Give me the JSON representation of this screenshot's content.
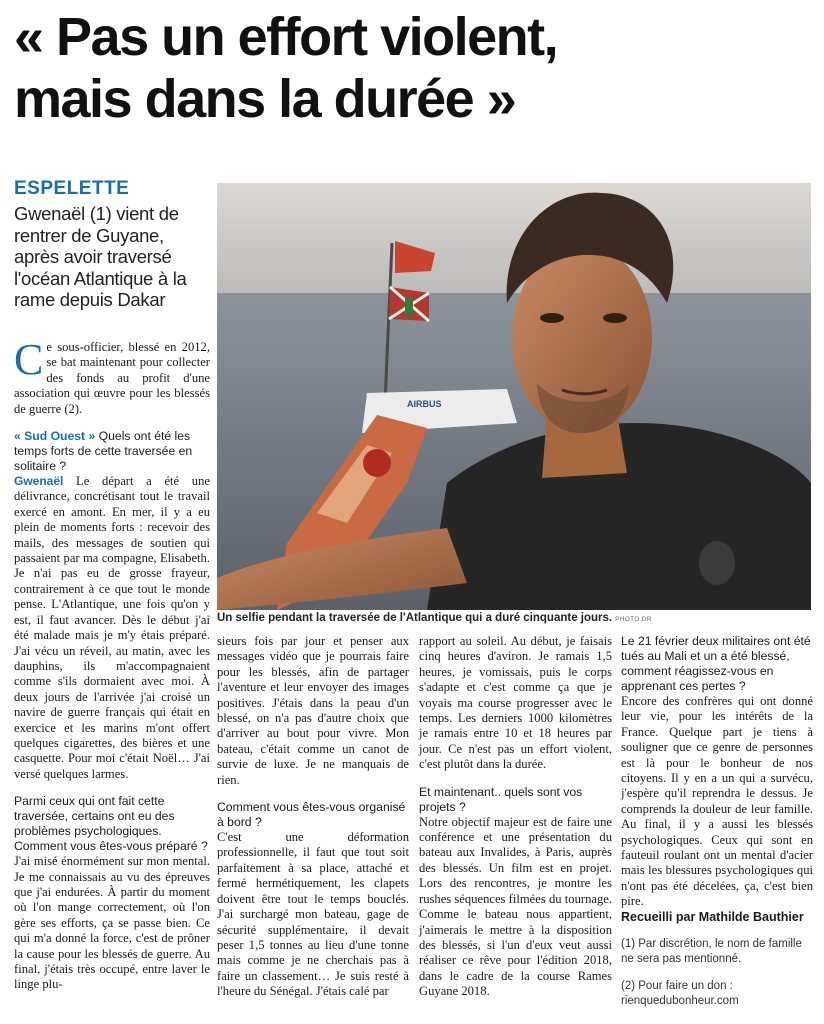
{
  "headline": {
    "line1": "« Pas un effort violent,",
    "line2": "mais dans la durée »"
  },
  "kicker": "ESPELETTE",
  "standfirst": "Gwenaël (1) vient de rentrer de Guyane, après avoir traversé l'océan Atlantique à la rame depuis Dakar",
  "photo": {
    "boat_label": "AIRBUS",
    "caption": "Un selfie pendant la traversée de l'Atlantique qui a duré cinquante jours.",
    "credit": "PHOTO DR"
  },
  "column1": {
    "intro_dropcap": "C",
    "intro": "e sous-officier, blessé en 2012, se bat maintenant pour collecter des fonds au profit d'une association qui œuvre pour les blessés de guerre (2).",
    "q1_lead": "« Sud Ouest »",
    "q1_rest": "Quels ont été les temps forts de cette traversée en solitaire ?",
    "a1_lead": "Gwenaël",
    "a1": "Le départ a été une délivrance, concrétisant tout le travail exercé en amont. En mer, il y a eu plein de moments forts : recevoir des mails, des messages de soutien qui passaient par ma compagne, Elisabeth. Je n'ai pas eu de grosse frayeur, contrairement à ce que tout le monde pense. L'Atlantique, une fois qu'on y est, il faut avancer. Dès le début j'ai été malade mais je m'y étais préparé. J'ai vécu un réveil, au matin, avec les dauphins, ils m'accompagnaient comme s'ils dormaient avec moi. À deux jours de l'arrivée j'ai croisé un navire de guerre français qui était en exercice et les marins m'ont offert quelques cigarettes, des bières et une casquette. Pour moi c'était Noël… J'ai versé quelques larmes.",
    "q2": "Parmi ceux qui ont fait cette traversée, certains ont eu des problèmes psychologiques. Comment vous êtes-vous préparé ?",
    "a2": "J'ai misé énormément sur mon mental. Je me connaissais au vu des épreuves que j'ai endurées. À partir du moment où l'on mange correctement, où l'on gère ses efforts, ça se passe bien. Ce qui m'a donné la force, c'est de prôner la cause pour les blessés de guerre. Au final, j'étais très occupé, entre laver le linge plu-"
  },
  "column2": {
    "a2_cont": "sieurs fois par jour et penser aux messages vidéo que je pourrais faire pour les blessés, afin de partager l'aventure et leur envoyer des images positives. J'étais dans la peau d'un blessé, on n'a pas d'autre choix que d'arriver au bout pour vivre. Mon bateau, c'était comme un canot de survie de luxe. Je ne manquais de rien.",
    "q3": "Comment vous êtes-vous organisé à bord ?",
    "a3": "C'est une déformation professionnelle, il faut que tout soit parfaitement à sa place, attaché et fermé hermétiquement, les clapets doivent être tout le temps bouclés. J'ai surchargé mon bateau, gage de sécurité supplémentaire, il devait peser 1,5 tonnes au lieu d'une tonne mais comme je ne cherchais pas à faire un classement… Je suis resté à l'heure du Sénégal. J'étais calé par"
  },
  "column3": {
    "a3_cont": "rapport au soleil. Au début, je faisais cinq heures d'aviron. Je ramais 1,5 heures, je vomissais, puis le corps s'adapte et c'est comme ça que je voyais ma course progresser avec le temps. Les derniers 1000 kilomètres je ramais entre 10 et 18 heures par jour. Ce n'est pas un effort violent, c'est plutôt dans la durée.",
    "q4": "Et maintenant.. quels sont vos projets ?",
    "a4": "Notre objectif majeur est de faire une conférence et une présentation du bateau aux Invalides, à Paris, auprès des blessés. Un film est en projet. Lors des rencontres, je montre les rushes séquences filmées du tournage. Comme le bateau nous appartient, j'aimerais le mettre à la disposition des blessés, si l'un d'eux veut aussi réaliser ce rêve pour l'édition 2018, dans le cadre de la course Rames Guyane 2018."
  },
  "column4": {
    "q5": "Le 21 février deux militaires ont été tués au Mali et un a été blessé, comment réagissez-vous en apprenant ces pertes ?",
    "a5": "Encore des confrères qui ont donné leur vie, pour les intérêts de la France. Quelque part je tiens à souligner que ce genre de personnes est là pour le bonheur de nos citoyens. Il y en a un qui a survécu, j'espère qu'il reprendra le dessus. Je comprends la douleur de leur famille. Au final, il y a aussi les blessés psychologiques. Ceux qui sont en fauteuil roulant ont un mental d'acier mais les blessures psychologiques qui n'ont pas été décelées, ça, c'est bien pire.",
    "signature": "Recueilli par Mathilde Bauthier",
    "note1": "(1) Par discrétion, le nom de famille ne sera pas mentionné.",
    "note2_label": "(2) Pour faire un don :",
    "note2_link": "rienquedubonheur.com"
  }
}
